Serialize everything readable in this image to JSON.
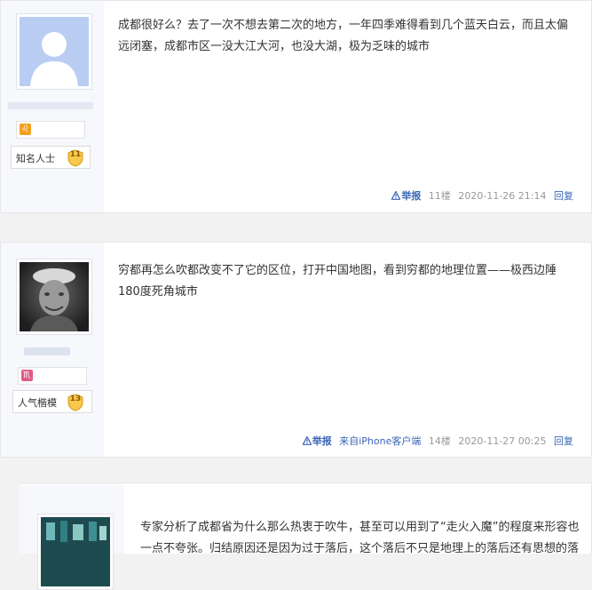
{
  "posts": [
    {
      "content": "成都很好么？去了一次不想去第二次的地方，一年四季难得看到几个蓝天白云，而且太偏远闭塞，成都市区一没大江大河，也没大湖，极为乏味的城市",
      "zodiac": "♌",
      "zodiac_color": "#f0a020",
      "level_title": "知名人士",
      "level_number": "11",
      "report_label": "举报",
      "floor": "11楼",
      "timestamp": "2020-11-26 21:14",
      "reply_label": "回复"
    },
    {
      "content": "穷都再怎么吹都改变不了它的区位，打开中国地图，看到穷都的地理位置——极西边陲180度死角城市",
      "zodiac": "♏",
      "zodiac_color": "#e05a8a",
      "level_title": "人气楷模",
      "level_number": "13",
      "report_label": "举报",
      "client": "来自iPhone客户端",
      "floor": "14楼",
      "timestamp": "2020-11-27 00:25",
      "reply_label": "回复"
    },
    {
      "content": "专家分析了成都省为什么那么热衷于吹牛，甚至可以用到了“走火入魔”的程度来形容也一点不夸张。归结原因还是因为过于落后，这个落后不只是地理上的落后还有思想的落"
    }
  ]
}
